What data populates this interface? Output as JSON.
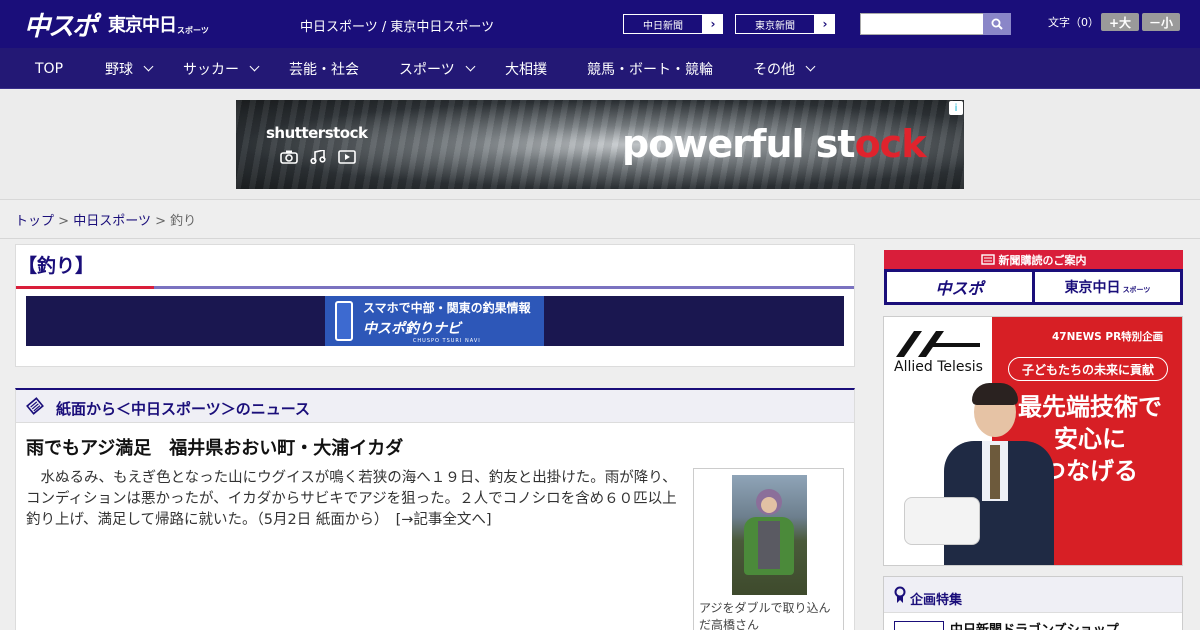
{
  "header": {
    "logo_main": "中スポ",
    "logo_sub": "東京中日",
    "logo_sub_small": "スポーツ",
    "site_links": "中日スポーツ / 東京中日スポーツ",
    "paper_buttons": [
      {
        "label": "中日新聞",
        "arrow": "›"
      },
      {
        "label": "東京新聞",
        "arrow": "›"
      }
    ],
    "search": {
      "placeholder": "",
      "value": ""
    },
    "font_size": {
      "label": "文字（0）",
      "larger": "+大",
      "smaller": "－小"
    }
  },
  "nav": {
    "items": [
      {
        "label": "TOP",
        "has_dropdown": false
      },
      {
        "label": "野球",
        "has_dropdown": true
      },
      {
        "label": "サッカー",
        "has_dropdown": true
      },
      {
        "label": "芸能・社会",
        "has_dropdown": false
      },
      {
        "label": "スポーツ",
        "has_dropdown": true
      },
      {
        "label": "大相撲",
        "has_dropdown": false
      },
      {
        "label": "競馬・ボート・競輪",
        "has_dropdown": false
      },
      {
        "label": "その他",
        "has_dropdown": true
      }
    ]
  },
  "top_ad": {
    "brand": "shutterstock",
    "title_white": "powerful st",
    "title_red1": "o",
    "title_red2": "ck",
    "info": "i"
  },
  "breadcrumb": {
    "top": "トップ",
    "section": "中日スポーツ",
    "current": "釣り",
    "sep": ">"
  },
  "category": {
    "title": "【釣り】",
    "banner": {
      "line1": "スマホで中部・関東の釣果情報",
      "line2": "中スポ釣りナビ",
      "line3": "CHUSPO TSURI NAVI"
    }
  },
  "news": {
    "section_title": "紙面から＜中日スポーツ＞のニュース",
    "article": {
      "title": "雨でもアジ満足　福井県おおい町・大浦イカダ",
      "body": "水ぬるみ、もえぎ色となった山にウグイスが鳴く若狭の海へ１９日、釣友と出掛けた。雨が降り、コンディションは悪かったが、イカダからサビキでアジを狙った。２人でコノシロを含め６０匹以上釣り上げ、満足して帰路に就いた。（5月2日 紙面から）　[→記事全文へ]",
      "photo_caption": "アジをダブルで取り込んだ高橋さん"
    }
  },
  "sidebar": {
    "subscribe": {
      "title": "新聞購読のご案内",
      "buttons": [
        "中スポ",
        "東京中日"
      ],
      "button2_small": "スポーツ"
    },
    "ad": {
      "company": "Allied Telesis",
      "pr": "47NEWS PR特別企画",
      "sub": "子どもたちの未来に貢献",
      "main": [
        "最先端技術で",
        "安心に",
        "つなげる"
      ]
    },
    "features": {
      "title": "企画特集",
      "item": "中日新聞ドラゴンズショップ"
    }
  },
  "colors": {
    "brand_navy": "#1a0e7a",
    "nav_bg": "#231875",
    "accent_red": "#d91e3a",
    "accent_purple": "#7a72c0"
  }
}
